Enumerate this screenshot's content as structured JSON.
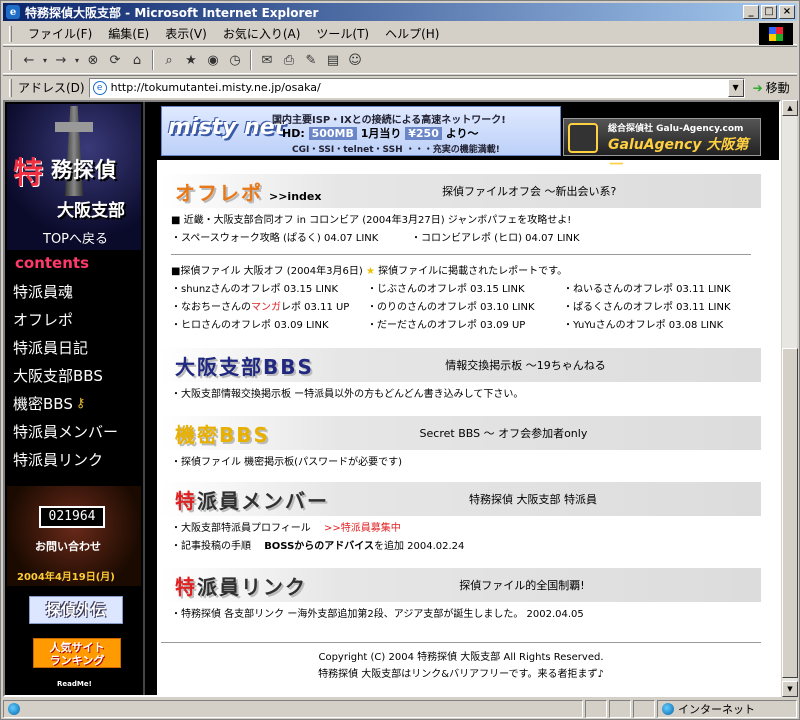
{
  "window": {
    "title": "特務探偵大阪支部 - Microsoft Internet Explorer",
    "ie_icon": "e"
  },
  "menu": [
    "ファイル(F)",
    "編集(E)",
    "表示(V)",
    "お気に入り(A)",
    "ツール(T)",
    "ヘルプ(H)"
  ],
  "address": {
    "label": "アドレス(D)",
    "url": "http://tokumutantei.misty.ne.jp/osaka/",
    "go": "移動"
  },
  "status": {
    "text": "",
    "zone": "インターネット"
  },
  "sidebar": {
    "banner_big": "特",
    "banner_title": "務探偵",
    "banner_sub": "大阪支部",
    "top_link": "TOPへ戻る",
    "contents": "contents",
    "nav": [
      "特派員魂",
      "オフレポ",
      "特派員日記",
      "大阪支部BBS",
      "機密BBS",
      "特派員メンバー",
      "特派員リンク"
    ],
    "counter": "021964",
    "contact": "お問い合わせ",
    "date": "2004年4月19日(月)",
    "badge1": "探偵外伝",
    "badge2_l1": "人気サイト",
    "badge2_l2": "ランキング",
    "readme": "ReadMe!"
  },
  "ads": {
    "misty_logo": "misty net",
    "misty_l1": "国内主要ISP・IXとの接続による高速ネットワーク!",
    "misty_hd": "HD:",
    "misty_size": "500MB",
    "misty_price_label": "1月当り",
    "misty_price": "¥250",
    "misty_price_suffix": "より〜",
    "misty_l3": "CGI・SSI・telnet・SSH ・・・充実の機能満載!",
    "galu_l1": "総合探偵社 Galu-Agency.com",
    "galu_l2": "GaluAgency 大阪第一"
  },
  "sections": {
    "offrepo": {
      "title": "オフレポ",
      "index": ">>index",
      "right": "探偵ファイルオフ会 〜新出会い系?",
      "line1": "■ 近畿・大阪支部合同オフ in コロンビア (2004年3月27日) ジャンボパフェを攻略せよ!",
      "line2a": "・スペースウォーク攻略 (ぱるく) 04.07 LINK",
      "line2b": "・コロンビアレポ (ヒロ) 04.07 LINK",
      "line3a": "■探偵ファイル 大阪オフ (2004年3月6日)",
      "line3b": "探偵ファイルに掲載されたレポートです。",
      "grid": [
        [
          "・shunzさんのオフレポ 03.15 LINK",
          "・じぶさんのオフレポ 03.15 LINK",
          "・ねいるさんのオフレポ 03.11 LINK"
        ],
        [
          "・なおちーさんの",
          "・のりのさんのオフレポ 03.10 LINK",
          "・ぱるくさんのオフレポ 03.11 LINK"
        ],
        [
          "・ヒロさんのオフレポ 03.09 LINK",
          "・だーださんのオフレポ 03.09 UP",
          "・YuYuさんのオフレポ 03.08 LINK"
        ]
      ],
      "manga": "マンガ",
      "manga_suffix": "レポ 03.11 UP"
    },
    "bbs": {
      "title": "大阪支部BBS",
      "right": "情報交換掲示板 〜19ちゃんねる",
      "line": "・大阪支部情報交換掲示板 ー特派員以外の方もどんどん書き込みして下さい。"
    },
    "secret": {
      "title": "機密BBS",
      "right": "Secret BBS 〜 オフ会参加者only",
      "line": "・探偵ファイル 機密掲示板(パスワードが必要です)"
    },
    "members": {
      "title_red": "特",
      "title_rest": "派員メンバー",
      "right": "特務探偵 大阪支部 特派員",
      "line1a": "・大阪支部特派員プロフィール",
      "line1b": ">>特派員募集中",
      "line2a": "・記事投稿の手順",
      "line2b": "BOSSからのアドバイス",
      "line2c": "を追加 2004.02.24"
    },
    "links": {
      "title_red": "特",
      "title_rest": "派員リンク",
      "right": "探偵ファイル的全国制覇!",
      "line": "・特務探偵 各支部リンク ー海外支部追加第2段、アジア支部が誕生しました。 2002.04.05"
    }
  },
  "footer": {
    "l1": "Copyright (C) 2004 特務探偵 大阪支部 All Rights Reserved.",
    "l2": "特務探偵 大阪支部はリンク&バリアフリーです。来る者拒まず♪"
  }
}
